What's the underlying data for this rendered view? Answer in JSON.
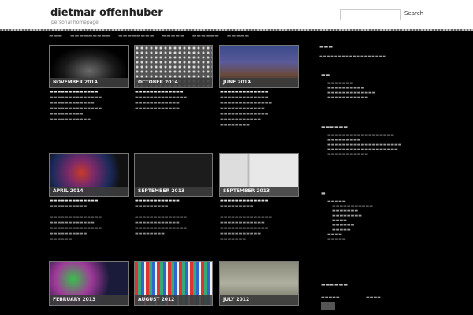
{
  "header": {
    "site_title": "dietmar offenhuber",
    "tagline": "personal homepage",
    "search_button": "Search"
  },
  "posts": [
    {
      "date": "NOVEMBER 2014"
    },
    {
      "date": "OCTOBER 2014"
    },
    {
      "date": "JUNE 2014"
    },
    {
      "date": "APRIL 2014"
    },
    {
      "date": "SEPTEMBER 2013"
    },
    {
      "date": "SEPTEMBER 2013"
    },
    {
      "date": "FEBRUARY 2013"
    },
    {
      "date": "AUGUST 2012"
    },
    {
      "date": "JULY 2012"
    }
  ],
  "colors": {
    "header_bg": "#ffffff",
    "page_bg": "#000000",
    "caption_bg": "#3c3c3c"
  }
}
